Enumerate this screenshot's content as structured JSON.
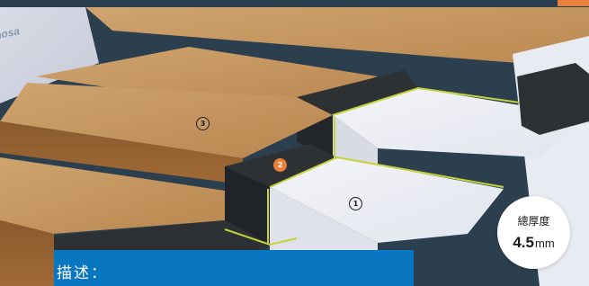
{
  "markers": [
    {
      "number": "1",
      "style": "outline"
    },
    {
      "number": "2",
      "style": "filled"
    },
    {
      "number": "3",
      "style": "outline"
    }
  ],
  "thickness_badge": {
    "label": "總厚度",
    "value": "4.5",
    "unit": "mm"
  },
  "description_banner": {
    "text": "描述："
  },
  "wall_logo_text": "nosa",
  "colors": {
    "header_bar": "#2b3f4e",
    "accent_orange": "#e9803a",
    "banner_blue": "#0876c0",
    "wood_top": "#c99a66",
    "black_membrane": "#2e3134",
    "white_substrate": "#eceef4",
    "edge_yellow": "#c7d23a"
  }
}
